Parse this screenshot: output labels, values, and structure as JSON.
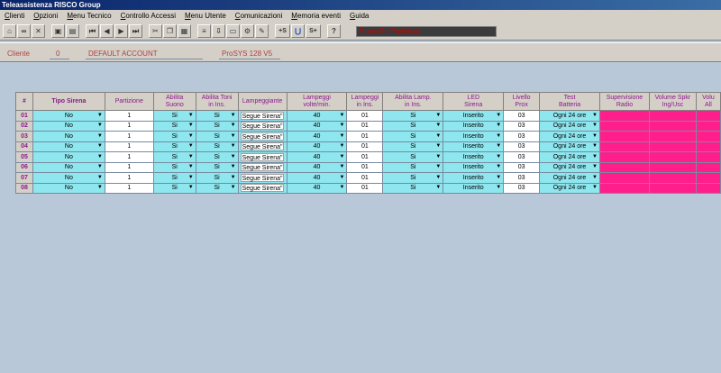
{
  "window": {
    "title": "Teleassistenza RISCO Group"
  },
  "menu": [
    "Clienti",
    "Opzioni",
    "Menu Tecnico",
    "Controllo Accessi",
    "Menu Utente",
    "Comunicazioni",
    "Memoria eventi",
    "Guida"
  ],
  "toolbar": {
    "sp_label": "+S",
    "sm_label": "S+",
    "help_label": "?",
    "status_text": "Risco Srl Partenza"
  },
  "info": {
    "cliente_label": "Cliente",
    "cliente_id": "0",
    "account_name": "DEFAULT ACCOUNT",
    "panel_model": "ProSYS 128 V5"
  },
  "table": {
    "headers": [
      [
        "#"
      ],
      [
        "Tipo Sirena"
      ],
      [
        "Partizione"
      ],
      [
        "Abilita",
        "Suono"
      ],
      [
        "Abilita Toni",
        "in Ins."
      ],
      [
        "Lampeggiante"
      ],
      [
        "Lampeggi",
        "volte/min."
      ],
      [
        "Lampeggi",
        "in Ins."
      ],
      [
        "Abilita Lamp.",
        "in Ins."
      ],
      [
        "LED",
        "Sirena"
      ],
      [
        "Livello",
        "Prox"
      ],
      [
        "Test",
        "Batteria"
      ],
      [
        "Supervisione",
        "Radio"
      ],
      [
        "Volume Spkr",
        "Ing/Usc"
      ],
      [
        "Volu",
        "All"
      ]
    ],
    "rows": [
      {
        "num": "01",
        "tipo": "No",
        "partizione": "1",
        "suono": "Si",
        "toni": "Si",
        "lampeggiante": "Segue Sirena\"",
        "volte": "40",
        "lamp_ins": "01",
        "abil_lamp": "Si",
        "led": "Inserito",
        "prox": "03",
        "test": "Ogni 24 ore"
      },
      {
        "num": "02",
        "tipo": "No",
        "partizione": "1",
        "suono": "Si",
        "toni": "Si",
        "lampeggiante": "Segue Sirena\"",
        "volte": "40",
        "lamp_ins": "01",
        "abil_lamp": "Si",
        "led": "Inserito",
        "prox": "03",
        "test": "Ogni 24 ore"
      },
      {
        "num": "03",
        "tipo": "No",
        "partizione": "1",
        "suono": "Si",
        "toni": "Si",
        "lampeggiante": "Segue Sirena\"",
        "volte": "40",
        "lamp_ins": "01",
        "abil_lamp": "Si",
        "led": "Inserito",
        "prox": "03",
        "test": "Ogni 24 ore"
      },
      {
        "num": "04",
        "tipo": "No",
        "partizione": "1",
        "suono": "Si",
        "toni": "Si",
        "lampeggiante": "Segue Sirena\"",
        "volte": "40",
        "lamp_ins": "01",
        "abil_lamp": "Si",
        "led": "Inserito",
        "prox": "03",
        "test": "Ogni 24 ore"
      },
      {
        "num": "05",
        "tipo": "No",
        "partizione": "1",
        "suono": "Si",
        "toni": "Si",
        "lampeggiante": "Segue Sirena\"",
        "volte": "40",
        "lamp_ins": "01",
        "abil_lamp": "Si",
        "led": "Inserito",
        "prox": "03",
        "test": "Ogni 24 ore"
      },
      {
        "num": "06",
        "tipo": "No",
        "partizione": "1",
        "suono": "Si",
        "toni": "Si",
        "lampeggiante": "Segue Sirena\"",
        "volte": "40",
        "lamp_ins": "01",
        "abil_lamp": "Si",
        "led": "Inserito",
        "prox": "03",
        "test": "Ogni 24 ore"
      },
      {
        "num": "07",
        "tipo": "No",
        "partizione": "1",
        "suono": "Si",
        "toni": "Si",
        "lampeggiante": "Segue Sirena\"",
        "volte": "40",
        "lamp_ins": "01",
        "abil_lamp": "Si",
        "led": "Inserito",
        "prox": "03",
        "test": "Ogni 24 ore"
      },
      {
        "num": "08",
        "tipo": "No",
        "partizione": "1",
        "suono": "Si",
        "toni": "Si",
        "lampeggiante": "Segue Sirena\"",
        "volte": "40",
        "lamp_ins": "01",
        "abil_lamp": "Si",
        "led": "Inserito",
        "prox": "03",
        "test": "Ogni 24 ore"
      }
    ]
  },
  "colors": {
    "cyan_cell": "#8ee6ee",
    "magenta_cell": "#ff1e8c",
    "header_text": "#8a1a8a",
    "background": "#b9c8d9"
  }
}
